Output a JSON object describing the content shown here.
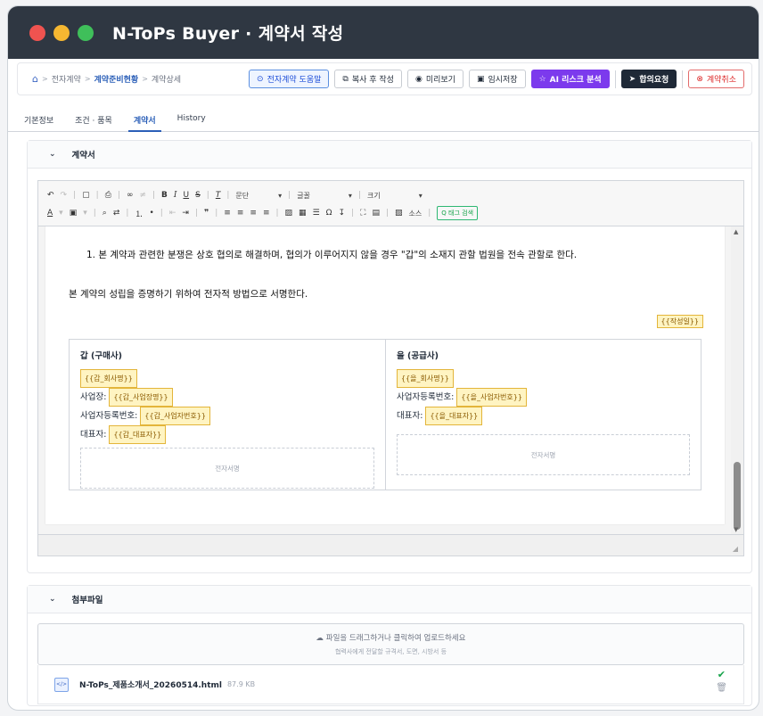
{
  "window": {
    "title": "N-ToPs Buyer · 계약서 작성"
  },
  "breadcrumb": {
    "items": [
      "전자계약",
      "계약준비현황",
      "계약상세"
    ]
  },
  "toolbar": {
    "guide": "전자계약 도움말",
    "copy": "복사 후 작성",
    "preview": "미리보기",
    "save": "임시저장",
    "ai": "AI 리스크 분석",
    "request": "합의요청",
    "cancel": "계약취소"
  },
  "tabs": [
    "기본정보",
    "조건 · 품목",
    "계약서",
    "History"
  ],
  "contract_section": {
    "title": "계약서"
  },
  "editor_toolbar": {
    "paragraph": "문단",
    "font": "글꼴",
    "size": "크기",
    "source": "소스",
    "check": "Q 태그 검색"
  },
  "document": {
    "clause": "1. 본 계약과 관련한 분쟁은 상호 협의로 해결하며, 협의가 이루어지지 않을 경우 \"갑\"의 소재지 관할 법원을 전속 관할로 한다.",
    "closing": "본 계약의 성립을 증명하기 위하여 전자적 방법으로 서명한다.",
    "date_ph": "{{작성일}}",
    "party_a": {
      "title": "갑 (구매사)",
      "company_ph": "{{갑_회사명}}",
      "addr_label": "사업장:",
      "addr_ph": "{{갑_사업장명}}",
      "regno_label": "사업자등록번호:",
      "regno_ph": "{{갑_사업자번호}}",
      "ceo_label": "대표자:",
      "ceo_ph": "{{갑_대표자}}",
      "sign": "전자서명"
    },
    "party_b": {
      "title": "을 (공급사)",
      "company_ph": "{{을_회사명}}",
      "regno_label": "사업자등록번호:",
      "regno_ph": "{{을_사업자번호}}",
      "ceo_label": "대표자:",
      "ceo_ph": "{{을_대표자}}",
      "sign": "전자서명"
    }
  },
  "attachment_section": {
    "title": "첨부파일",
    "drop_main": "파일을 드래그하거나 클릭하여 업로드하세요",
    "drop_sub": "협력사에게 전달할 규격서, 도면, 시방서 등",
    "file_name": "N-ToPs_제품소개서_20260514.html",
    "file_size": "87.9 KB"
  },
  "colors": {
    "accent": "#2b5fb8",
    "purple": "#7c3aed",
    "title_bar": "#2f3742"
  }
}
